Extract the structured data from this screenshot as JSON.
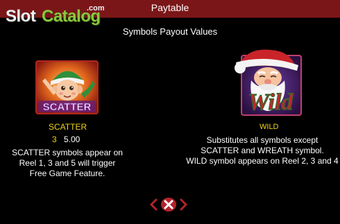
{
  "header": {
    "title": "Paytable"
  },
  "logo": {
    "part1": "Slot",
    "part2": "Catalog",
    "suffix": ".com"
  },
  "subtitle": "Symbols Payout Values",
  "symbols": [
    {
      "tile_label": "SCATTER",
      "name": "SCATTER",
      "payouts": [
        {
          "count": "3",
          "value": "5.00"
        }
      ],
      "description": [
        "SCATTER symbols appear on",
        "Reel 1, 3 and 5 will trigger",
        "Free Game Feature."
      ]
    },
    {
      "tile_label": "Wild",
      "name": "WILD",
      "description": [
        "Substitutes all symbols except",
        "SCATTER and WREATH symbol.",
        "WILD symbol appears on Reel 2, 3 and 4"
      ]
    }
  ],
  "nav": {
    "prev_icon": "chevron-left-icon",
    "close_icon": "close-icon",
    "next_icon": "chevron-right-icon"
  },
  "colors": {
    "header_bg": "#7b1618",
    "accent_yellow": "#f0d21b",
    "nav_red": "#b3232b",
    "logo_green": "#8cc63f"
  }
}
